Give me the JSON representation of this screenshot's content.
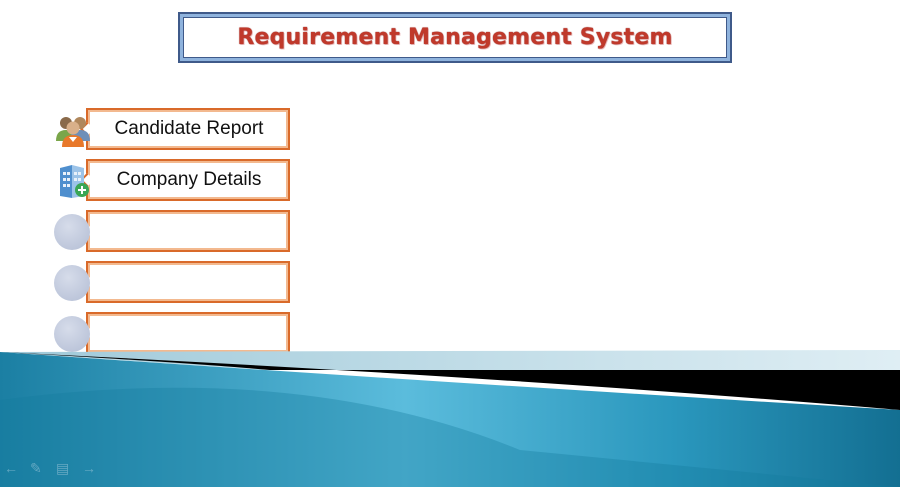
{
  "title": "Requirement Management System",
  "menu": {
    "items": [
      {
        "label": "Candidate Report",
        "icon": "people-icon"
      },
      {
        "label": "Company Details",
        "icon": "building-icon"
      },
      {
        "label": "",
        "icon": "circle-placeholder"
      },
      {
        "label": "",
        "icon": "circle-placeholder"
      },
      {
        "label": "",
        "icon": "circle-placeholder"
      }
    ]
  },
  "nav": {
    "prev_icon": "arrow-left-icon",
    "pen_icon": "pen-icon",
    "menu_icon": "slide-menu-icon",
    "next_icon": "arrow-right-icon"
  },
  "colors": {
    "title_text": "#c0392b",
    "title_border": "#3f5a8a",
    "item_border": "#d96a2a",
    "band_teal": "#1f86a8",
    "band_dark": "#000000"
  }
}
